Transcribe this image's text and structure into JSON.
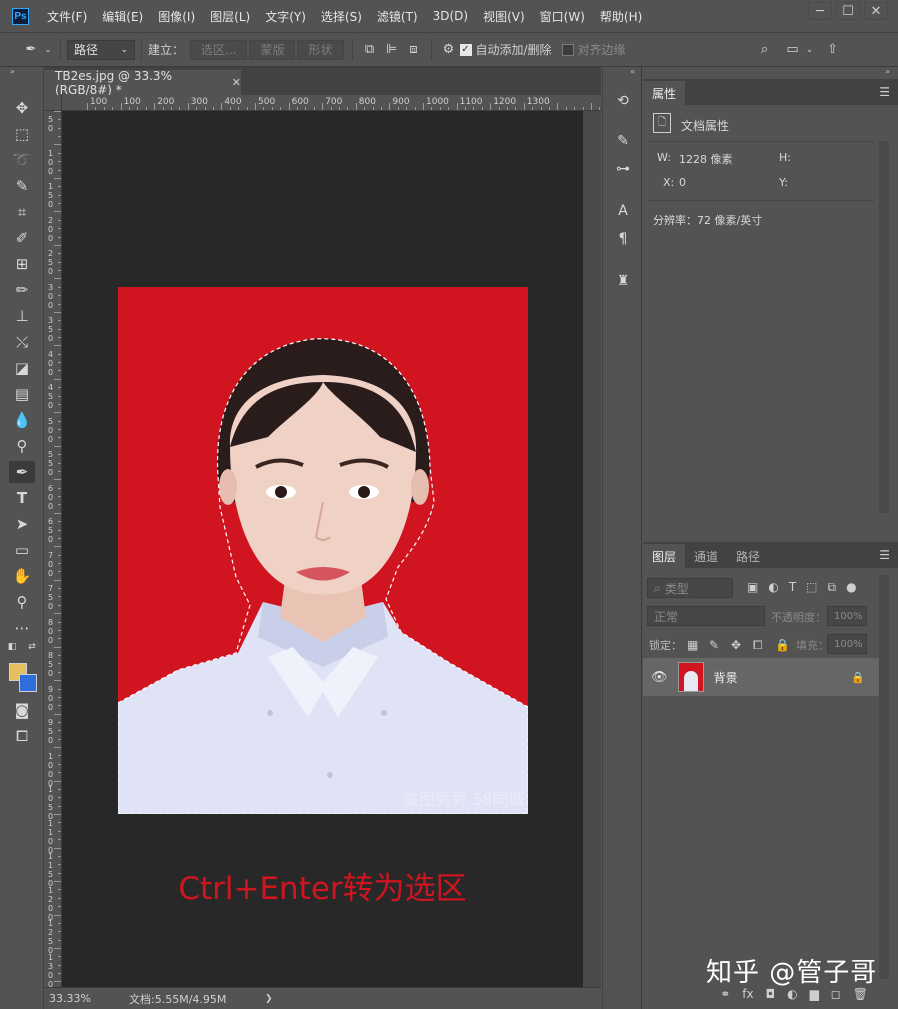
{
  "app": {
    "logo": "Ps"
  },
  "menu": [
    "文件(F)",
    "编辑(E)",
    "图像(I)",
    "图层(L)",
    "文字(Y)",
    "选择(S)",
    "滤镜(T)",
    "3D(D)",
    "视图(V)",
    "窗口(W)",
    "帮助(H)"
  ],
  "options": {
    "mode_value": "路径",
    "build_label": "建立：",
    "selection_btn": "选区...",
    "mask_btn": "蒙版",
    "shape_btn": "形状",
    "auto_add_delete": "自动添加/删除",
    "align_edges": "对齐边缘"
  },
  "document": {
    "tab_title": "TB2es.jpg @ 33.3%(RGB/8#) *",
    "ruler_top_labels": [
      "100",
      "100",
      "200",
      "300",
      "400",
      "500",
      "600",
      "700",
      "800",
      "900",
      "1000",
      "1100",
      "1200",
      "1300"
    ],
    "ruler_left_labels": [
      "5 0",
      "1 0 0",
      "1 5 0",
      "2 0 0",
      "2 5 0",
      "3 0 0",
      "3 5 0",
      "4 0 0",
      "4 5 0",
      "5 0 0",
      "5 5 0",
      "6 0 0",
      "6 5 0",
      "7 0 0",
      "7 5 0",
      "8 0 0",
      "8 5 0",
      "9 0 0",
      "9 5 0",
      "1 0 0 0",
      "1 0 5 0",
      "1 1 0 0",
      "1 1 5 0",
      "1 2 0 0",
      "1 2 5 0",
      "1 3 0 0",
      "1 3 5 0",
      "1 4 0 0"
    ],
    "caption": "Ctrl+Enter转为选区",
    "photo_watermark": "美图秀秀  58同城"
  },
  "status": {
    "zoom": "33.33%",
    "doc_info": "文档:5.55M/4.95M",
    "arrow": "❯"
  },
  "properties": {
    "tab": "属性",
    "doc_props": "文档属性",
    "w_label": "W:",
    "w_value": "1228 像素",
    "h_label": "H:",
    "x_label": "X:",
    "x_value": "0",
    "y_label": "Y:",
    "resolution": "分辨率：72 像素/英寸"
  },
  "layers": {
    "tabs": [
      "图层",
      "通道",
      "路径"
    ],
    "kind_filter": "类型",
    "blend_mode": "正常",
    "opacity_label": "不透明度：",
    "opacity_value": "100%",
    "lock_label": "锁定：",
    "fill_label": "填充：",
    "fill_value": "100%",
    "layer_name": "背景",
    "bottom_icons": [
      "⚭",
      "fx",
      "◘",
      "◐",
      "▆",
      "◻",
      "🗑"
    ]
  },
  "watermark": "知乎 @管子哥",
  "colors": {
    "foreground": "#e5c15d",
    "background": "#2f6fdd",
    "photo_bg": "#d01420",
    "caption": "#d01420"
  }
}
